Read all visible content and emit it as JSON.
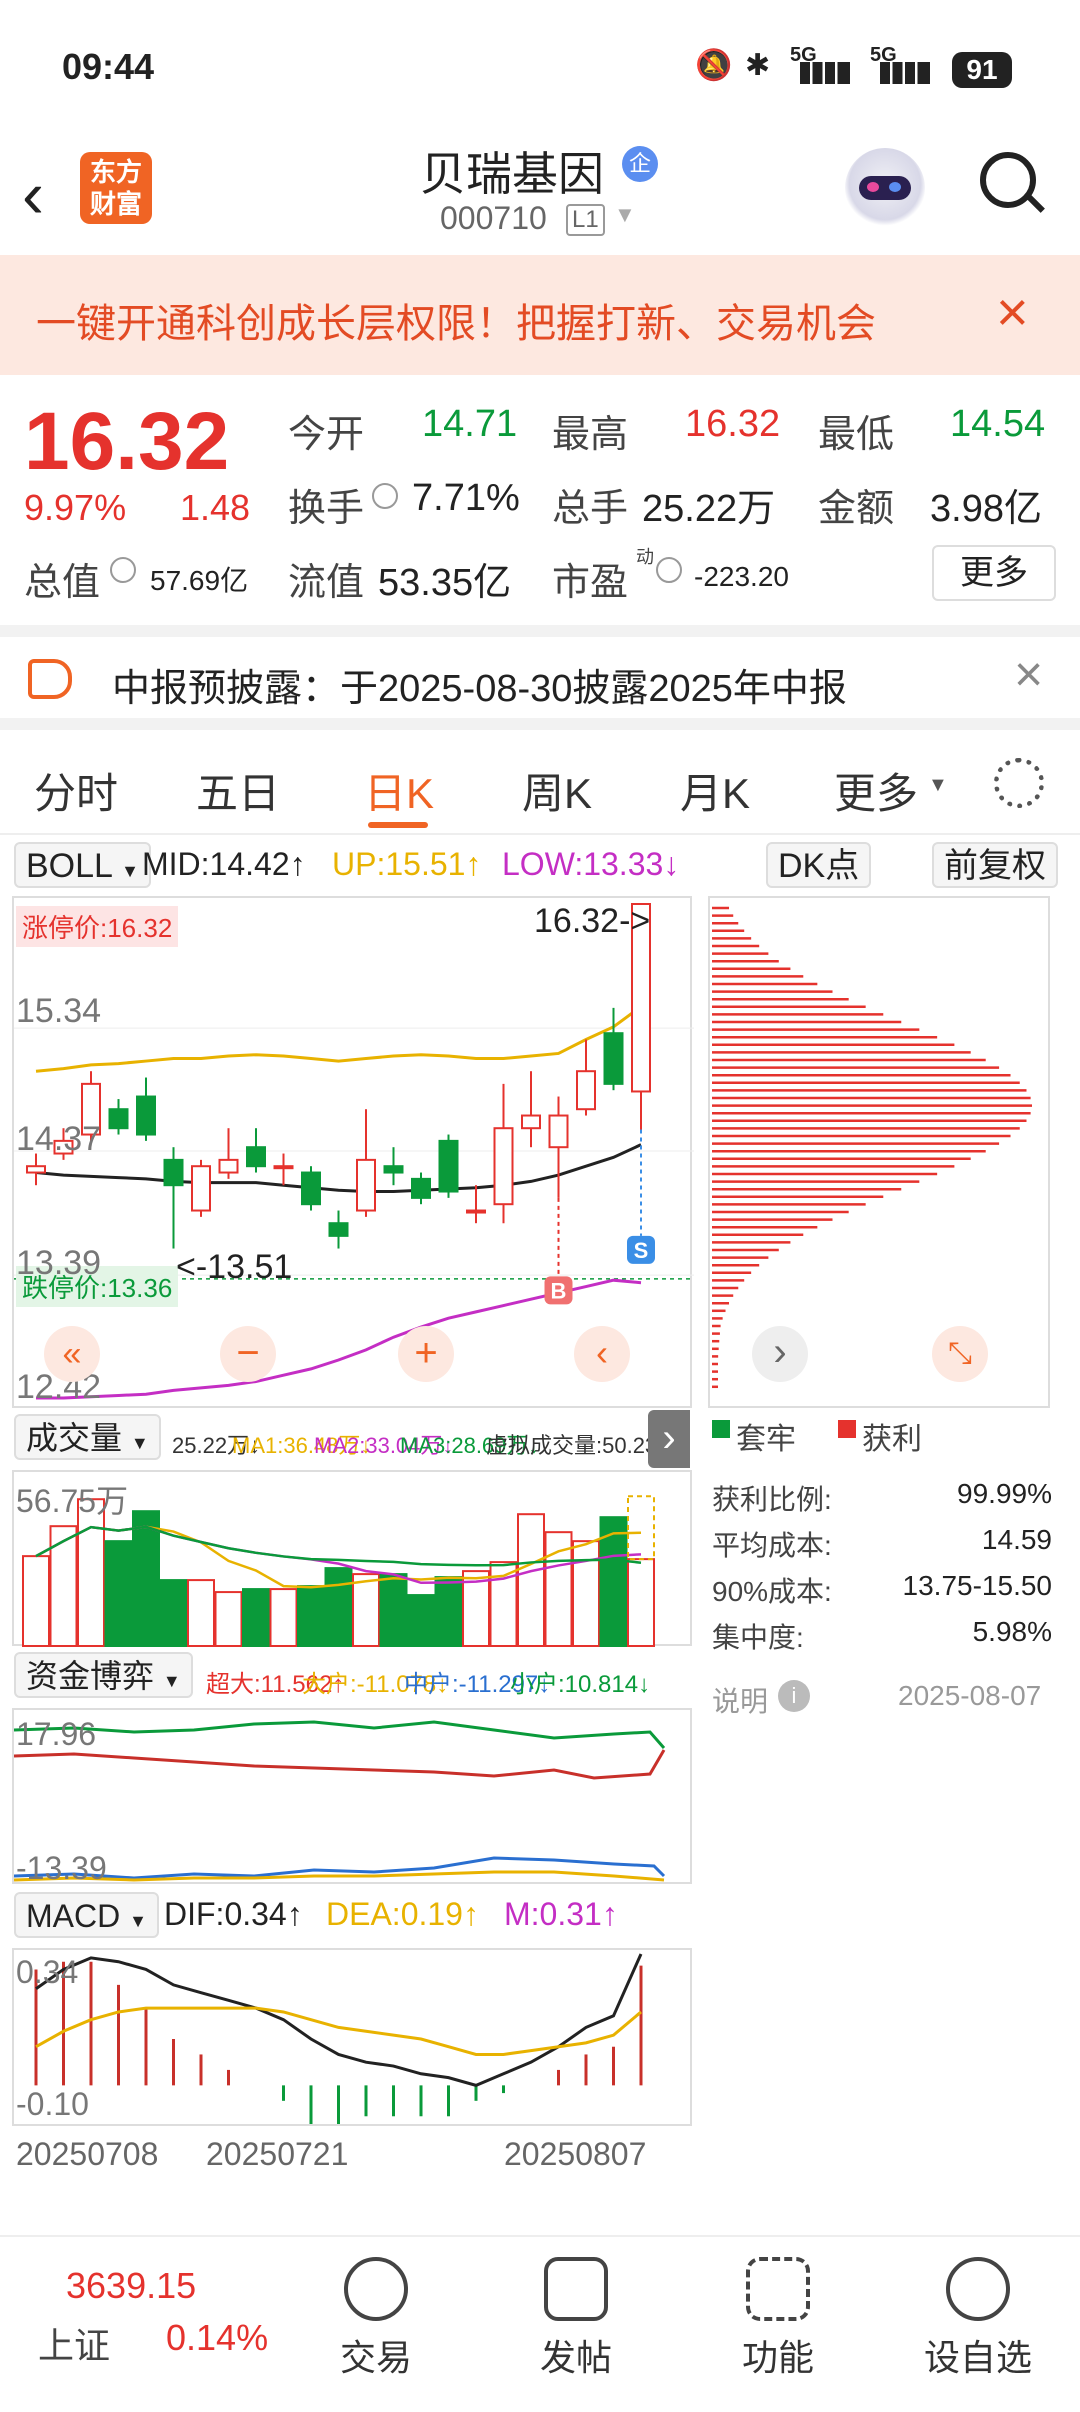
{
  "status": {
    "time": "09:44",
    "battery": "91",
    "net1": "5G",
    "net2": "5G"
  },
  "nav": {
    "title": "贝瑞基因",
    "badge": "企",
    "code": "000710",
    "level": "L1",
    "logo_line1": "东方",
    "logo_line2": "财富"
  },
  "banner": {
    "text": "一键开通科创成长层权限！把握打新、交易机会"
  },
  "quote": {
    "price": "16.32",
    "pct": "9.97%",
    "chg": "1.48",
    "open_label": "今开",
    "open": "14.71",
    "high_label": "最高",
    "high": "16.32",
    "low_label": "最低",
    "low": "14.54",
    "turnover_label": "换手",
    "turnover": "7.71%",
    "vol_label": "总手",
    "vol": "25.22万",
    "amount_label": "金额",
    "amount": "3.98亿",
    "mktcap_label": "总值",
    "mktcap": "57.69亿",
    "float_label": "流值",
    "float": "53.35亿",
    "pe_label": "市盈",
    "pe_sup": "动",
    "pe": "-223.20",
    "more": "更多"
  },
  "notice": {
    "text": "中报预披露：于2025-08-30披露2025年中报"
  },
  "tabs": [
    "分时",
    "五日",
    "日K",
    "周K",
    "月K",
    "更多"
  ],
  "indicator": {
    "name": "BOLL",
    "mid": "MID:14.42↑",
    "up": "UP:15.51↑",
    "low": "LOW:13.33↓",
    "dk": "DK点",
    "fq": "前复权"
  },
  "kline": {
    "limit_up": "涨停价:16.32",
    "limit_down": "跌停价:13.36",
    "y_labels": [
      "15.34",
      "14.37",
      "13.39",
      "12.42"
    ],
    "max_label": "16.32->",
    "min_label": "<-13.51",
    "b_mark": "B",
    "s_mark": "S"
  },
  "volume": {
    "name": "成交量",
    "vals": "25.22万↓",
    "ma1": "MA1:36.48万↓",
    "ma2": "MA2:33.04万↓",
    "ma3": "MA3:28.69万↓",
    "virt": "虚拟成交量:50.23万",
    "ymax": "56.75万"
  },
  "funds": {
    "name": "资金博弈",
    "big": "超大:11.562↑",
    "large": "大户:-11.078↓",
    "mid": "中户:-11.297↓",
    "small": "小户:10.814↓",
    "ymax": "17.96",
    "ymin": "-13.39"
  },
  "macd": {
    "name": "MACD",
    "dif": "DIF:0.34↑",
    "dea": "DEA:0.19↑",
    "m": "M:0.31↑",
    "ymax": "0.34",
    "ymin": "-0.10"
  },
  "dates": [
    "20250708",
    "20250721",
    "20250807"
  ],
  "chips": {
    "legend_trapped": "套牢",
    "legend_profit": "获利",
    "rows": [
      {
        "label": "获利比例:",
        "value": "99.99%"
      },
      {
        "label": "平均成本:",
        "value": "14.59"
      },
      {
        "label": "90%成本:",
        "value": "13.75-15.50"
      },
      {
        "label": "集中度:",
        "value": "5.98%"
      }
    ],
    "note": "说明",
    "date": "2025-08-07"
  },
  "bottom": {
    "index_value": "3639.15",
    "index_name": "上证",
    "index_pct": "0.14%",
    "items": [
      "交易",
      "发帖",
      "功能",
      "设自选"
    ]
  },
  "chart_data": {
    "type": "candlestick",
    "candles": [
      {
        "o": 14.2,
        "c": 14.25,
        "h": 14.35,
        "l": 14.1
      },
      {
        "o": 14.35,
        "c": 14.45,
        "h": 14.55,
        "l": 14.3
      },
      {
        "o": 14.5,
        "c": 14.9,
        "h": 15.0,
        "l": 14.45
      },
      {
        "o": 14.7,
        "c": 14.55,
        "h": 14.78,
        "l": 14.5
      },
      {
        "o": 14.8,
        "c": 14.5,
        "h": 14.95,
        "l": 14.45
      },
      {
        "o": 14.3,
        "c": 14.1,
        "h": 14.4,
        "l": 13.6
      },
      {
        "o": 13.9,
        "c": 14.25,
        "h": 14.3,
        "l": 13.85
      },
      {
        "o": 14.2,
        "c": 14.3,
        "h": 14.55,
        "l": 14.15
      },
      {
        "o": 14.4,
        "c": 14.25,
        "h": 14.55,
        "l": 14.2
      },
      {
        "o": 14.25,
        "c": 14.25,
        "h": 14.35,
        "l": 14.1
      },
      {
        "o": 14.2,
        "c": 13.95,
        "h": 14.25,
        "l": 13.9
      },
      {
        "o": 13.8,
        "c": 13.7,
        "h": 13.9,
        "l": 13.6
      },
      {
        "o": 13.9,
        "c": 14.3,
        "h": 14.7,
        "l": 13.85
      },
      {
        "o": 14.25,
        "c": 14.2,
        "h": 14.4,
        "l": 14.1
      },
      {
        "o": 14.15,
        "c": 14.0,
        "h": 14.2,
        "l": 13.95
      },
      {
        "o": 14.45,
        "c": 14.05,
        "h": 14.5,
        "l": 14.0
      },
      {
        "o": 13.9,
        "c": 13.9,
        "h": 14.1,
        "l": 13.8
      },
      {
        "o": 13.95,
        "c": 14.55,
        "h": 14.9,
        "l": 13.8
      },
      {
        "o": 14.55,
        "c": 14.65,
        "h": 15.0,
        "l": 14.4
      },
      {
        "o": 14.4,
        "c": 14.65,
        "h": 14.8,
        "l": 14.0
      },
      {
        "o": 14.7,
        "c": 15.0,
        "h": 15.25,
        "l": 14.65
      },
      {
        "o": 15.3,
        "c": 14.9,
        "h": 15.5,
        "l": 14.85
      },
      {
        "o": 14.84,
        "c": 16.32,
        "h": 16.32,
        "l": 14.54
      }
    ],
    "boll_up": [
      15.0,
      15.02,
      15.05,
      15.06,
      15.08,
      15.1,
      15.1,
      15.12,
      15.13,
      15.12,
      15.1,
      15.08,
      15.1,
      15.12,
      15.13,
      15.12,
      15.1,
      15.1,
      15.12,
      15.14,
      15.25,
      15.35,
      15.51
    ],
    "boll_mid": [
      14.2,
      14.18,
      14.17,
      14.16,
      14.15,
      14.13,
      14.12,
      14.12,
      14.12,
      14.1,
      14.08,
      14.06,
      14.05,
      14.05,
      14.06,
      14.07,
      14.08,
      14.1,
      14.13,
      14.18,
      14.25,
      14.32,
      14.42
    ],
    "boll_low": [
      12.42,
      12.42,
      12.43,
      12.44,
      12.45,
      12.48,
      12.5,
      12.52,
      12.55,
      12.6,
      12.65,
      12.72,
      12.8,
      12.9,
      12.98,
      13.05,
      13.1,
      13.15,
      13.2,
      13.25,
      13.3,
      13.35,
      13.33
    ],
    "volume": [
      30,
      40,
      49,
      35,
      45,
      22,
      22,
      18,
      19,
      19,
      20,
      26,
      24,
      24,
      17,
      23,
      25,
      28,
      44,
      38,
      35,
      43,
      29
    ],
    "macd_dif": [
      0.25,
      0.3,
      0.33,
      0.32,
      0.3,
      0.26,
      0.24,
      0.22,
      0.2,
      0.17,
      0.12,
      0.08,
      0.06,
      0.05,
      0.03,
      0.02,
      0.0,
      0.03,
      0.06,
      0.1,
      0.15,
      0.18,
      0.34
    ],
    "macd_dea": [
      0.1,
      0.14,
      0.17,
      0.19,
      0.2,
      0.2,
      0.2,
      0.2,
      0.2,
      0.19,
      0.17,
      0.15,
      0.14,
      0.13,
      0.12,
      0.1,
      0.08,
      0.08,
      0.09,
      0.1,
      0.11,
      0.13,
      0.19
    ],
    "macd_bar": [
      0.3,
      0.32,
      0.32,
      0.26,
      0.2,
      0.12,
      0.08,
      0.04,
      0.0,
      -0.04,
      -0.1,
      -0.1,
      -0.08,
      -0.08,
      -0.08,
      -0.08,
      -0.04,
      -0.02,
      0.0,
      0.04,
      0.08,
      0.1,
      0.31
    ]
  }
}
